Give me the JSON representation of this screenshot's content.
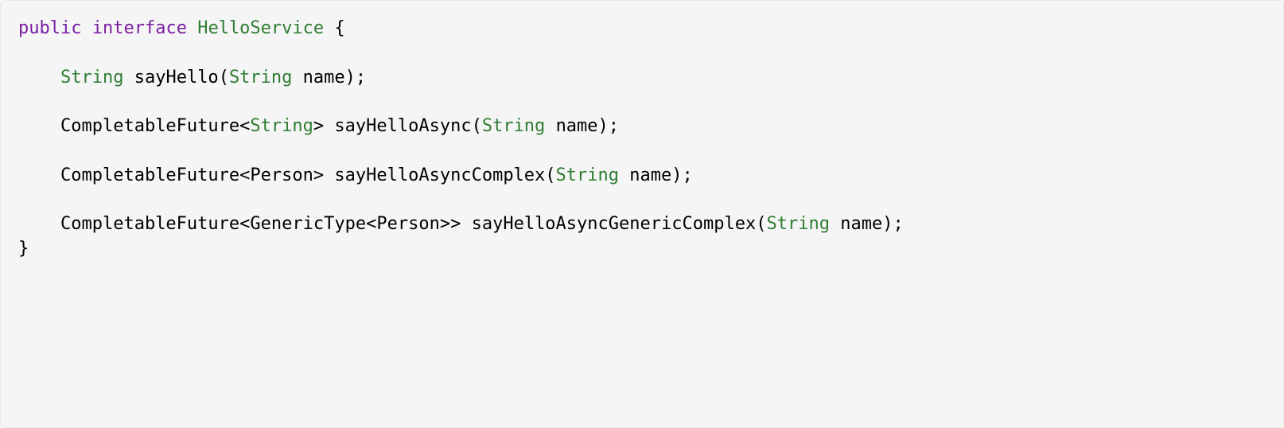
{
  "code": {
    "keywords": {
      "public": "public",
      "interface": "interface"
    },
    "interfaceName": "HelloService",
    "types": {
      "string": "String",
      "completableFuture": "CompletableFuture",
      "person": "Person",
      "genericType": "GenericType"
    },
    "methods": {
      "sayHello": "sayHello",
      "sayHelloAsync": "sayHelloAsync",
      "sayHelloAsyncComplex": "sayHelloAsyncComplex",
      "sayHelloAsyncGenericComplex": "sayHelloAsyncGenericComplex"
    },
    "param": "name",
    "symbols": {
      "openBrace": "{",
      "closeBrace": "}",
      "openParen": "(",
      "closeParen": ")",
      "semicolon": ";",
      "lt": "<",
      "gt": ">",
      "space": " "
    }
  }
}
